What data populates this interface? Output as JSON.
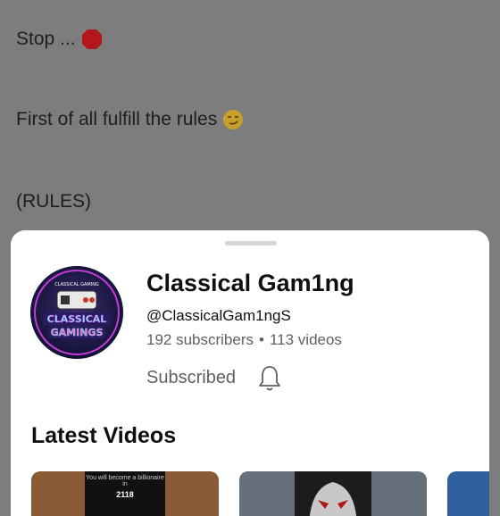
{
  "background": {
    "line1": "Stop ...",
    "line2": "First of all fulfill the rules",
    "line3": "(RULES)",
    "icon1": "stop-sign-icon",
    "icon2": "smirk-emoji-icon"
  },
  "channel": {
    "name": "Classical Gam1ng",
    "handle": "@ClassicalGam1ngS",
    "subscribers": "192 subscribers",
    "separator": "•",
    "videos": "113 videos",
    "subscribed_label": "Subscribed",
    "avatar_logo_top": "CLASSICAL GAMING",
    "avatar_logo_line1": "CLASSICAL",
    "avatar_logo_line2": "GAMINGS"
  },
  "latest": {
    "title": "Latest Videos",
    "thumb1_caption": "You will become a billionaire in",
    "thumb1_year": "2118"
  },
  "colors": {
    "overlay": "#7d7d7d",
    "sheet": "#ffffff",
    "primary_text": "#0f0f0f",
    "secondary_text": "#606060"
  }
}
